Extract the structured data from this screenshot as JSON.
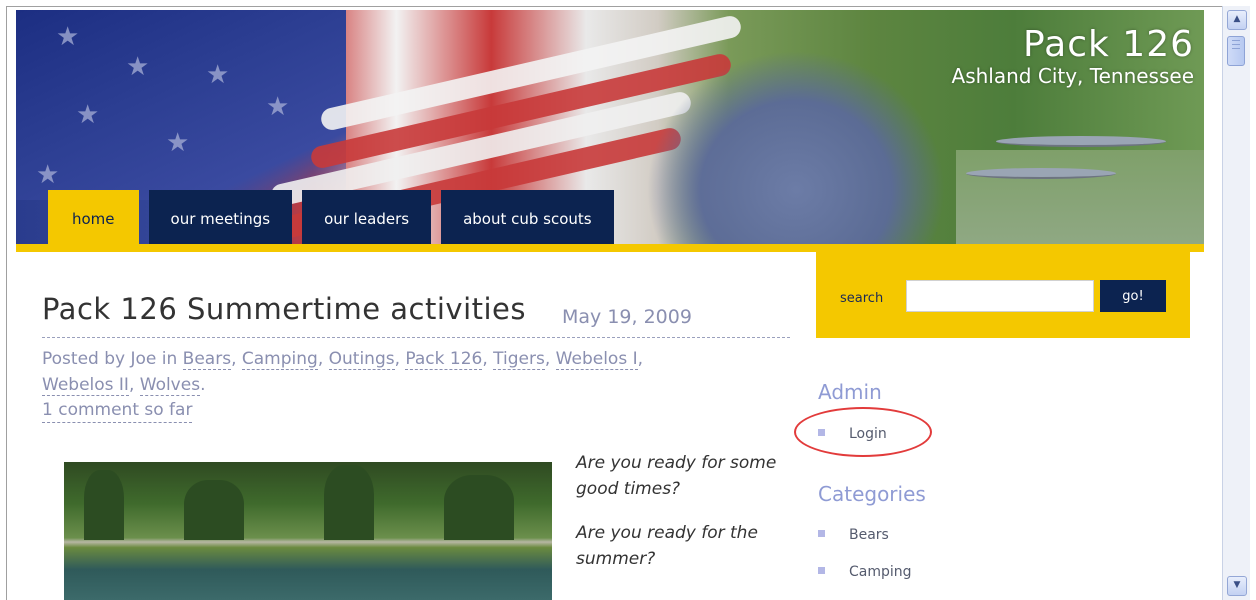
{
  "site": {
    "title": "Pack 126",
    "subtitle": "Ashland City, Tennessee"
  },
  "nav": {
    "tabs": [
      {
        "label": "home",
        "active": true
      },
      {
        "label": "our meetings"
      },
      {
        "label": "our leaders"
      },
      {
        "label": "about cub scouts"
      }
    ]
  },
  "search": {
    "label": "search",
    "input_value": "",
    "button_label": "go!"
  },
  "post": {
    "title": "Pack 126 Summertime activities",
    "date": "May 19, 2009",
    "posted_by_prefix": "Posted by Joe in",
    "categories": [
      "Bears",
      "Camping",
      "Outings",
      "Pack 126",
      "Tigers",
      "Webelos I",
      "Webelos II",
      "Wolves"
    ],
    "comments": "1 comment so far",
    "body": [
      "Are you ready for some good times?",
      "Are you ready for the summer?"
    ]
  },
  "sidebar": {
    "admin_heading": "Admin",
    "admin_items": [
      "Login"
    ],
    "categories_heading": "Categories",
    "category_items": [
      "Bears",
      "Camping"
    ]
  },
  "colors": {
    "nav_bg": "#0c2350",
    "accent_yellow": "#f4c800",
    "meta_text": "#8a8fb0",
    "sidebar_heading": "#8f9bd4",
    "highlight": "#e23b3b"
  },
  "icons": {
    "scroll_up": "scroll-up-arrow-icon",
    "scroll_down": "scroll-down-arrow-icon",
    "bullet": "square-bullet-icon"
  }
}
